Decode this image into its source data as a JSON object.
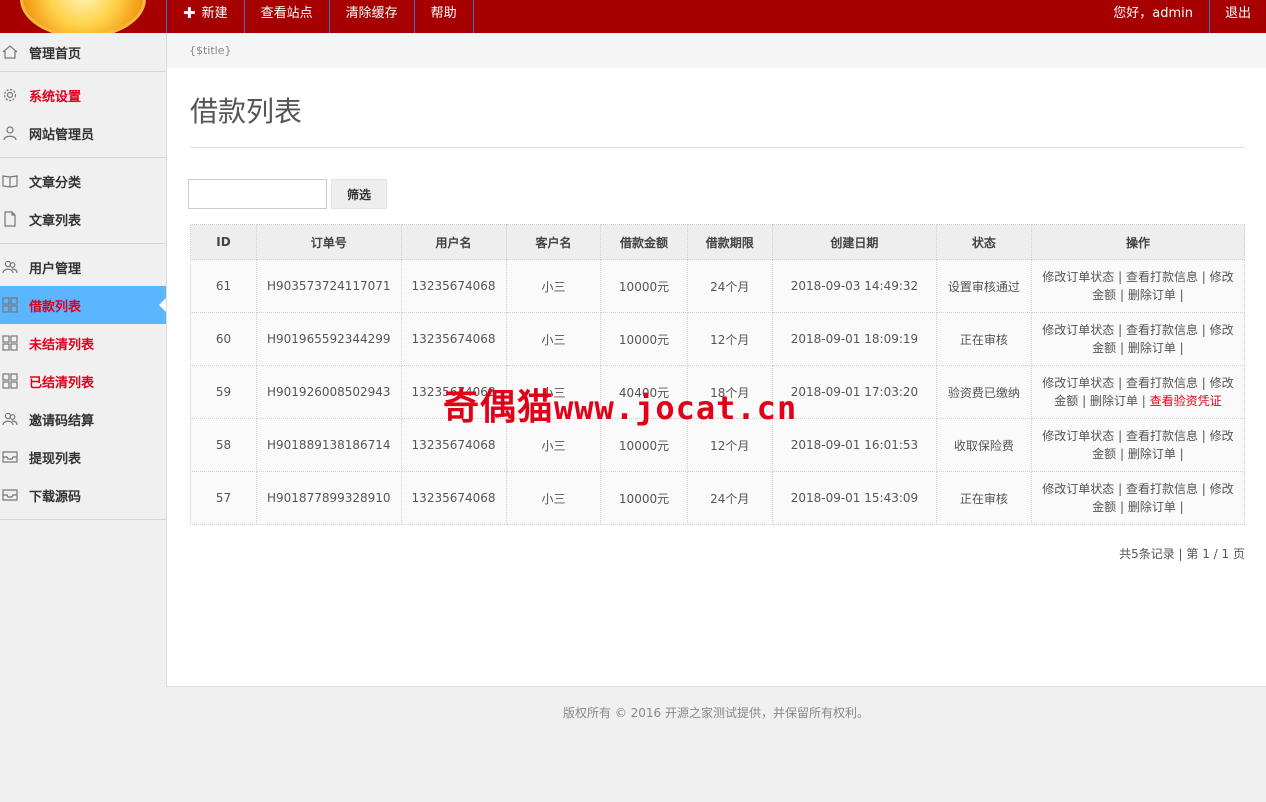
{
  "topnav": {
    "items": [
      {
        "label": "新建",
        "icon": "plus-icon"
      },
      {
        "label": "查看站点"
      },
      {
        "label": "清除缓存"
      },
      {
        "label": "帮助"
      }
    ],
    "greeting": "您好，admin",
    "logout": "退出"
  },
  "sidebar": {
    "items": [
      {
        "label": "管理首页",
        "icon": "home-icon"
      },
      {
        "label": "系统设置",
        "icon": "gear-icon"
      },
      {
        "label": "网站管理员",
        "icon": "user-icon"
      },
      {
        "label": "文章分类",
        "icon": "book-icon"
      },
      {
        "label": "文章列表",
        "icon": "file-icon"
      },
      {
        "label": "用户管理",
        "icon": "users-icon"
      },
      {
        "label": "借款列表",
        "icon": "grid-icon"
      },
      {
        "label": "未结清列表",
        "icon": "grid-icon"
      },
      {
        "label": "已结清列表",
        "icon": "grid-icon"
      },
      {
        "label": "邀请码结算",
        "icon": "users-icon"
      },
      {
        "label": "提现列表",
        "icon": "inbox-icon"
      },
      {
        "label": "下载源码",
        "icon": "inbox-icon"
      }
    ]
  },
  "main": {
    "breadcrumb": "{$title}",
    "title": "借款列表",
    "filter_button": "筛选",
    "filter_value": "",
    "columns": [
      "ID",
      "订单号",
      "用户名",
      "客户名",
      "借款金额",
      "借款期限",
      "创建日期",
      "状态",
      "操作"
    ],
    "rows": [
      {
        "id": "61",
        "order": "H903573724117071",
        "user": "13235674068",
        "customer": "小三",
        "amount": "10000元",
        "term": "24个月",
        "date": "2018-09-03 14:49:32",
        "status": "设置审核通过",
        "ops": [
          "修改订单状态",
          "查看打款信息",
          "修改金额",
          "删除订单"
        ],
        "extra_op": ""
      },
      {
        "id": "60",
        "order": "H901965592344299",
        "user": "13235674068",
        "customer": "小三",
        "amount": "10000元",
        "term": "12个月",
        "date": "2018-09-01 18:09:19",
        "status": "正在审核",
        "ops": [
          "修改订单状态",
          "查看打款信息",
          "修改金额",
          "删除订单"
        ],
        "extra_op": ""
      },
      {
        "id": "59",
        "order": "H901926008502943",
        "user": "13235674068",
        "customer": "小三",
        "amount": "40400元",
        "term": "18个月",
        "date": "2018-09-01 17:03:20",
        "status": "验资费已缴纳",
        "ops": [
          "修改订单状态",
          "查看打款信息",
          "修改金额",
          "删除订单"
        ],
        "extra_op": "查看验资凭证"
      },
      {
        "id": "58",
        "order": "H901889138186714",
        "user": "13235674068",
        "customer": "小三",
        "amount": "10000元",
        "term": "12个月",
        "date": "2018-09-01 16:01:53",
        "status": "收取保险费",
        "ops": [
          "修改订单状态",
          "查看打款信息",
          "修改金额",
          "删除订单"
        ],
        "extra_op": ""
      },
      {
        "id": "57",
        "order": "H901877899328910",
        "user": "13235674068",
        "customer": "小三",
        "amount": "10000元",
        "term": "24个月",
        "date": "2018-09-01 15:43:09",
        "status": "正在审核",
        "ops": [
          "修改订单状态",
          "查看打款信息",
          "修改金额",
          "删除订单"
        ],
        "extra_op": ""
      }
    ],
    "pager": "共5条记录 | 第 1 / 1 页"
  },
  "footer": "版权所有 © 2016 开源之家测试提供，并保留所有权利。",
  "watermark": {
    "cn": "奇偶猫",
    "url": "www.jocat.cn"
  },
  "colors": {
    "topbar": "#a60000",
    "accent_red": "#e0001b",
    "active_item": "#5bb5ff"
  }
}
